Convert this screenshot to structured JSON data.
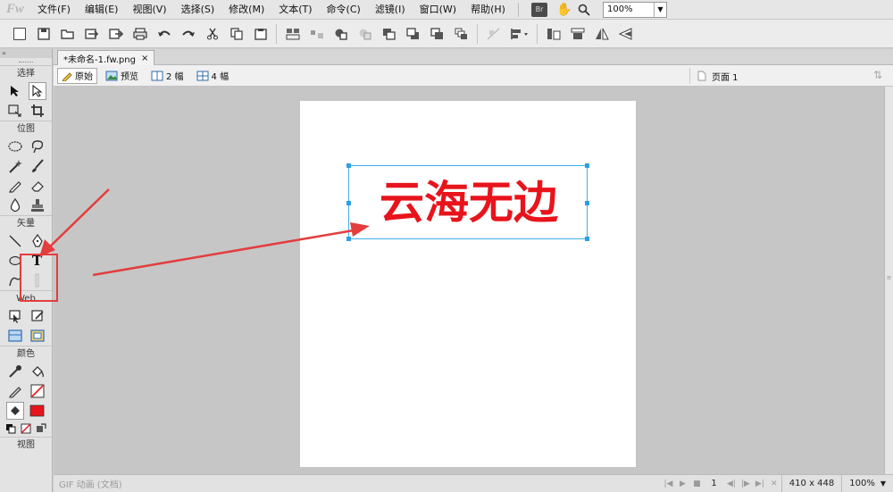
{
  "app": {
    "logo": "Fw"
  },
  "menu": {
    "items": [
      "文件(F)",
      "编辑(E)",
      "视图(V)",
      "选择(S)",
      "修改(M)",
      "文本(T)",
      "命令(C)",
      "滤镜(I)",
      "窗口(W)",
      "帮助(H)"
    ],
    "bridge_label": "Br",
    "zoom": "100%"
  },
  "tools_panel": {
    "sections": [
      "选择",
      "位图",
      "矢量",
      "Web",
      "颜色",
      "视图"
    ],
    "text_tool_glyph": "T"
  },
  "document_tab": {
    "title": "*未命名-1.fw.png",
    "close": "×"
  },
  "view_bar": {
    "original": "原始",
    "preview": "预览",
    "two_up": "2 幅",
    "four_up": "4 幅",
    "page": "页面 1"
  },
  "canvas": {
    "text": "云海无边",
    "text_color": "#e8141c",
    "selection_color": "#3fb0e6"
  },
  "status": {
    "left": "GIF 动画 (文档)",
    "frame": "1",
    "size": "410 x 448",
    "zoom": "100%"
  },
  "annotation_color": "#e33d3d"
}
